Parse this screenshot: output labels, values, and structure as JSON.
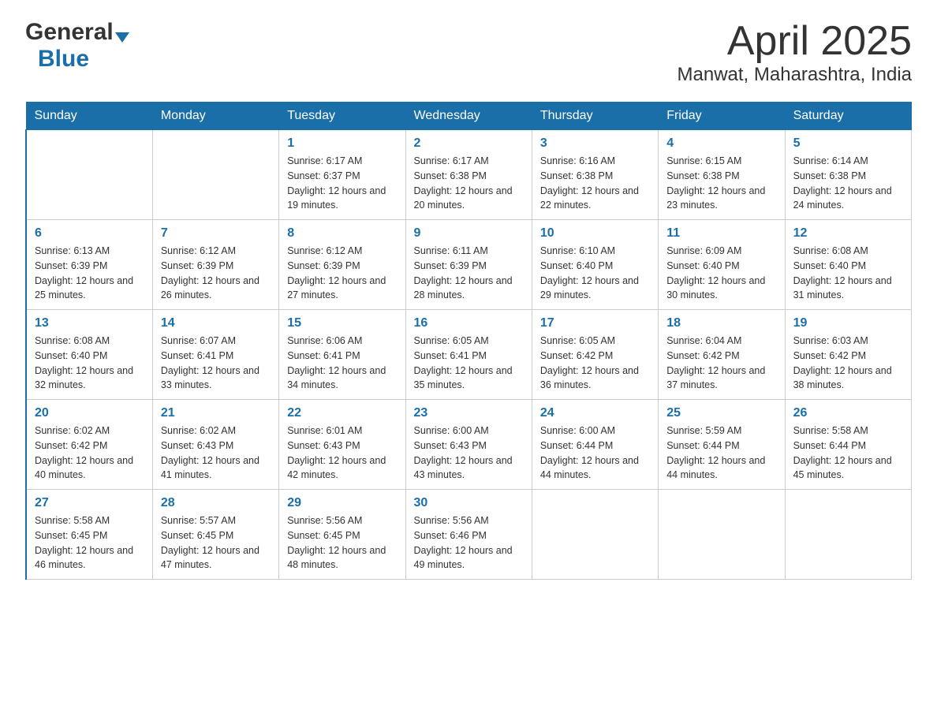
{
  "header": {
    "logo_general": "General",
    "logo_blue": "Blue",
    "title": "April 2025",
    "subtitle": "Manwat, Maharashtra, India"
  },
  "calendar": {
    "days_of_week": [
      "Sunday",
      "Monday",
      "Tuesday",
      "Wednesday",
      "Thursday",
      "Friday",
      "Saturday"
    ],
    "weeks": [
      [
        {
          "day": "",
          "sunrise": "",
          "sunset": "",
          "daylight": ""
        },
        {
          "day": "",
          "sunrise": "",
          "sunset": "",
          "daylight": ""
        },
        {
          "day": "1",
          "sunrise": "Sunrise: 6:17 AM",
          "sunset": "Sunset: 6:37 PM",
          "daylight": "Daylight: 12 hours and 19 minutes."
        },
        {
          "day": "2",
          "sunrise": "Sunrise: 6:17 AM",
          "sunset": "Sunset: 6:38 PM",
          "daylight": "Daylight: 12 hours and 20 minutes."
        },
        {
          "day": "3",
          "sunrise": "Sunrise: 6:16 AM",
          "sunset": "Sunset: 6:38 PM",
          "daylight": "Daylight: 12 hours and 22 minutes."
        },
        {
          "day": "4",
          "sunrise": "Sunrise: 6:15 AM",
          "sunset": "Sunset: 6:38 PM",
          "daylight": "Daylight: 12 hours and 23 minutes."
        },
        {
          "day": "5",
          "sunrise": "Sunrise: 6:14 AM",
          "sunset": "Sunset: 6:38 PM",
          "daylight": "Daylight: 12 hours and 24 minutes."
        }
      ],
      [
        {
          "day": "6",
          "sunrise": "Sunrise: 6:13 AM",
          "sunset": "Sunset: 6:39 PM",
          "daylight": "Daylight: 12 hours and 25 minutes."
        },
        {
          "day": "7",
          "sunrise": "Sunrise: 6:12 AM",
          "sunset": "Sunset: 6:39 PM",
          "daylight": "Daylight: 12 hours and 26 minutes."
        },
        {
          "day": "8",
          "sunrise": "Sunrise: 6:12 AM",
          "sunset": "Sunset: 6:39 PM",
          "daylight": "Daylight: 12 hours and 27 minutes."
        },
        {
          "day": "9",
          "sunrise": "Sunrise: 6:11 AM",
          "sunset": "Sunset: 6:39 PM",
          "daylight": "Daylight: 12 hours and 28 minutes."
        },
        {
          "day": "10",
          "sunrise": "Sunrise: 6:10 AM",
          "sunset": "Sunset: 6:40 PM",
          "daylight": "Daylight: 12 hours and 29 minutes."
        },
        {
          "day": "11",
          "sunrise": "Sunrise: 6:09 AM",
          "sunset": "Sunset: 6:40 PM",
          "daylight": "Daylight: 12 hours and 30 minutes."
        },
        {
          "day": "12",
          "sunrise": "Sunrise: 6:08 AM",
          "sunset": "Sunset: 6:40 PM",
          "daylight": "Daylight: 12 hours and 31 minutes."
        }
      ],
      [
        {
          "day": "13",
          "sunrise": "Sunrise: 6:08 AM",
          "sunset": "Sunset: 6:40 PM",
          "daylight": "Daylight: 12 hours and 32 minutes."
        },
        {
          "day": "14",
          "sunrise": "Sunrise: 6:07 AM",
          "sunset": "Sunset: 6:41 PM",
          "daylight": "Daylight: 12 hours and 33 minutes."
        },
        {
          "day": "15",
          "sunrise": "Sunrise: 6:06 AM",
          "sunset": "Sunset: 6:41 PM",
          "daylight": "Daylight: 12 hours and 34 minutes."
        },
        {
          "day": "16",
          "sunrise": "Sunrise: 6:05 AM",
          "sunset": "Sunset: 6:41 PM",
          "daylight": "Daylight: 12 hours and 35 minutes."
        },
        {
          "day": "17",
          "sunrise": "Sunrise: 6:05 AM",
          "sunset": "Sunset: 6:42 PM",
          "daylight": "Daylight: 12 hours and 36 minutes."
        },
        {
          "day": "18",
          "sunrise": "Sunrise: 6:04 AM",
          "sunset": "Sunset: 6:42 PM",
          "daylight": "Daylight: 12 hours and 37 minutes."
        },
        {
          "day": "19",
          "sunrise": "Sunrise: 6:03 AM",
          "sunset": "Sunset: 6:42 PM",
          "daylight": "Daylight: 12 hours and 38 minutes."
        }
      ],
      [
        {
          "day": "20",
          "sunrise": "Sunrise: 6:02 AM",
          "sunset": "Sunset: 6:42 PM",
          "daylight": "Daylight: 12 hours and 40 minutes."
        },
        {
          "day": "21",
          "sunrise": "Sunrise: 6:02 AM",
          "sunset": "Sunset: 6:43 PM",
          "daylight": "Daylight: 12 hours and 41 minutes."
        },
        {
          "day": "22",
          "sunrise": "Sunrise: 6:01 AM",
          "sunset": "Sunset: 6:43 PM",
          "daylight": "Daylight: 12 hours and 42 minutes."
        },
        {
          "day": "23",
          "sunrise": "Sunrise: 6:00 AM",
          "sunset": "Sunset: 6:43 PM",
          "daylight": "Daylight: 12 hours and 43 minutes."
        },
        {
          "day": "24",
          "sunrise": "Sunrise: 6:00 AM",
          "sunset": "Sunset: 6:44 PM",
          "daylight": "Daylight: 12 hours and 44 minutes."
        },
        {
          "day": "25",
          "sunrise": "Sunrise: 5:59 AM",
          "sunset": "Sunset: 6:44 PM",
          "daylight": "Daylight: 12 hours and 44 minutes."
        },
        {
          "day": "26",
          "sunrise": "Sunrise: 5:58 AM",
          "sunset": "Sunset: 6:44 PM",
          "daylight": "Daylight: 12 hours and 45 minutes."
        }
      ],
      [
        {
          "day": "27",
          "sunrise": "Sunrise: 5:58 AM",
          "sunset": "Sunset: 6:45 PM",
          "daylight": "Daylight: 12 hours and 46 minutes."
        },
        {
          "day": "28",
          "sunrise": "Sunrise: 5:57 AM",
          "sunset": "Sunset: 6:45 PM",
          "daylight": "Daylight: 12 hours and 47 minutes."
        },
        {
          "day": "29",
          "sunrise": "Sunrise: 5:56 AM",
          "sunset": "Sunset: 6:45 PM",
          "daylight": "Daylight: 12 hours and 48 minutes."
        },
        {
          "day": "30",
          "sunrise": "Sunrise: 5:56 AM",
          "sunset": "Sunset: 6:46 PM",
          "daylight": "Daylight: 12 hours and 49 minutes."
        },
        {
          "day": "",
          "sunrise": "",
          "sunset": "",
          "daylight": ""
        },
        {
          "day": "",
          "sunrise": "",
          "sunset": "",
          "daylight": ""
        },
        {
          "day": "",
          "sunrise": "",
          "sunset": "",
          "daylight": ""
        }
      ]
    ]
  }
}
